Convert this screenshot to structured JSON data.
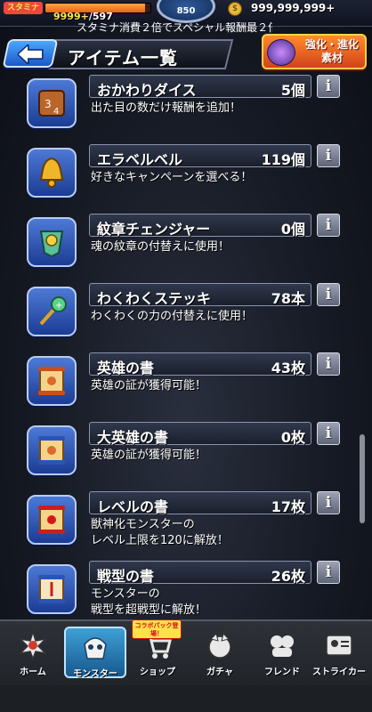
{
  "status": {
    "stamina_label": "スタミナ",
    "stamina_value": "9999+",
    "stamina_max": "/597",
    "stamina_fill_fraction": 0.95,
    "rank": "850",
    "coins": "999,999,999+",
    "ticker": "スタミナ消費２倍でスペシャル報酬最２倍"
  },
  "header": {
    "title": "アイテム一覧",
    "evo_button_line1": "強化・進化",
    "evo_button_line2": "素材"
  },
  "items": [
    {
      "name": "おかわりダイス",
      "count": "5個",
      "desc": "出た目の数だけ報酬を追加！",
      "icon": "dice-icon"
    },
    {
      "name": "エラベルベル",
      "count": "119個",
      "desc": "好きなキャンペーンを選べる！",
      "icon": "bell-icon"
    },
    {
      "name": "紋章チェンジャー",
      "count": "0個",
      "desc": "魂の紋章の付替えに使用！",
      "icon": "emblem-changer-icon"
    },
    {
      "name": "わくわくステッキ",
      "count": "78本",
      "desc": "わくわくの力の付替えに使用！",
      "icon": "wand-icon"
    },
    {
      "name": "英雄の書",
      "count": "43枚",
      "desc": "英雄の証が獲得可能！",
      "icon": "scroll-icon"
    },
    {
      "name": "大英雄の書",
      "count": "0枚",
      "desc": "英雄の証が獲得可能！",
      "icon": "scroll-icon"
    },
    {
      "name": "レベルの書",
      "count": "17枚",
      "desc": "獣神化モンスターの\nレベル上限を120に解放！",
      "icon": "scroll-icon"
    },
    {
      "name": "戦型の書",
      "count": "26枚",
      "desc": "モンスターの\n戦型を超戦型に解放！",
      "icon": "scroll-icon"
    }
  ],
  "info_label": "i",
  "nav": {
    "items": [
      {
        "label": "ホーム",
        "icon": "home-icon"
      },
      {
        "label": "モンスター",
        "icon": "monster-icon"
      },
      {
        "label": "ショップ",
        "icon": "cart-icon"
      },
      {
        "label": "ガチャ",
        "icon": "gacha-icon"
      },
      {
        "label": "フレンド",
        "icon": "friends-icon"
      },
      {
        "label": "ストライカー",
        "icon": "striker-icon"
      }
    ],
    "shop_badge": "コラボパック登場！",
    "active_index": 1
  },
  "colors": {
    "accent_blue": "#1c58c8",
    "evo_orange": "#d2421b",
    "stamina_orange": "#e8641b"
  }
}
